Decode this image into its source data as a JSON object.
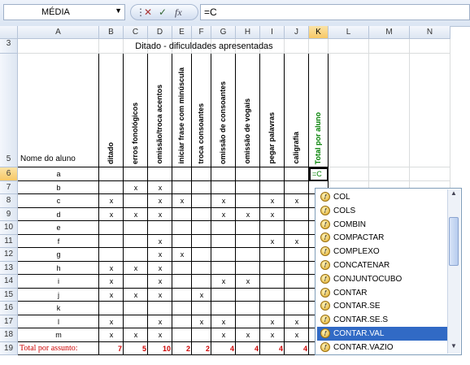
{
  "name_box": "MÉDIA",
  "formula": "=C",
  "columns": [
    "A",
    "B",
    "C",
    "D",
    "E",
    "F",
    "G",
    "H",
    "I",
    "J",
    "K",
    "L",
    "M",
    "N"
  ],
  "selected_column": "K",
  "title": "Ditado - dificuldades apresentadas",
  "row_header_label": "Nome  do aluno",
  "vertical_headers": [
    "ditado",
    "erros fonológicos",
    "omissão/troca acentos",
    "iniciar frase com minúscula",
    "troca consoantes",
    "omissão de consoantes",
    "omissão de vogais",
    "pegar palavras",
    "caligrafia",
    "Total por aluno"
  ],
  "editing_cell": "=C",
  "students": [
    {
      "row": "6",
      "name": "a",
      "marks": [
        "",
        "",
        "",
        "",
        "",
        "",
        "",
        "",
        ""
      ]
    },
    {
      "row": "7",
      "name": "b",
      "marks": [
        "",
        "x",
        "x",
        "",
        "",
        "",
        "",
        "",
        ""
      ]
    },
    {
      "row": "8",
      "name": "c",
      "marks": [
        "x",
        "",
        "x",
        "x",
        "",
        "x",
        "",
        "x",
        "x"
      ]
    },
    {
      "row": "9",
      "name": "d",
      "marks": [
        "x",
        "x",
        "x",
        "",
        "",
        "x",
        "x",
        "x",
        ""
      ]
    },
    {
      "row": "10",
      "name": "e",
      "marks": [
        "",
        "",
        "",
        "",
        "",
        "",
        "",
        "",
        ""
      ]
    },
    {
      "row": "11",
      "name": "f",
      "marks": [
        "",
        "",
        "x",
        "",
        "",
        "",
        "",
        "x",
        "x"
      ]
    },
    {
      "row": "12",
      "name": "g",
      "marks": [
        "",
        "",
        "x",
        "x",
        "",
        "",
        "",
        "",
        ""
      ]
    },
    {
      "row": "13",
      "name": "h",
      "marks": [
        "x",
        "x",
        "x",
        "",
        "",
        "",
        "",
        "",
        ""
      ]
    },
    {
      "row": "14",
      "name": "i",
      "marks": [
        "x",
        "",
        "x",
        "",
        "",
        "x",
        "x",
        "",
        ""
      ]
    },
    {
      "row": "15",
      "name": "j",
      "marks": [
        "x",
        "x",
        "x",
        "",
        "x",
        "",
        "",
        "",
        ""
      ]
    },
    {
      "row": "16",
      "name": "k",
      "marks": [
        "",
        "",
        "",
        "",
        "",
        "",
        "",
        "",
        ""
      ]
    },
    {
      "row": "17",
      "name": "l",
      "marks": [
        "x",
        "",
        "x",
        "",
        "x",
        "x",
        "",
        "x",
        "x"
      ]
    },
    {
      "row": "18",
      "name": "m",
      "marks": [
        "x",
        "x",
        "x",
        "",
        "",
        "x",
        "x",
        "x",
        "x"
      ]
    }
  ],
  "totals_label": "Total por assunto:",
  "totals": [
    "7",
    "5",
    "10",
    "2",
    "2",
    "4",
    "4",
    "4",
    "4"
  ],
  "autocomplete": [
    "COL",
    "COLS",
    "COMBIN",
    "COMPACTAR",
    "COMPLEXO",
    "CONCATENAR",
    "CONJUNTOCUBO",
    "CONTAR",
    "CONTAR.SE",
    "CONTAR.SE.S",
    "CONTAR.VAL",
    "CONTAR.VAZIO"
  ],
  "autocomplete_selected": "CONTAR.VAL",
  "colors": {
    "accent": "#316ac5",
    "totals": "#cc0000",
    "total_header": "#008000"
  }
}
